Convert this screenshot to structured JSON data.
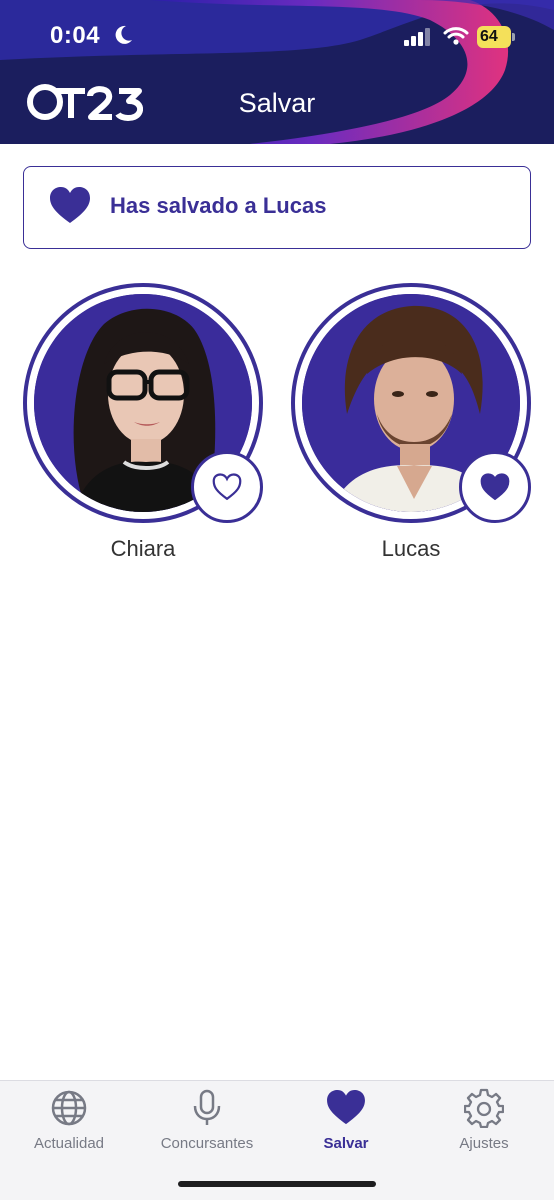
{
  "status_bar": {
    "time": "0:04",
    "battery": "64"
  },
  "header": {
    "logo_text": "OT23",
    "title": "Salvar"
  },
  "banner": {
    "icon": "heart-icon",
    "text": "Has salvado a Lucas"
  },
  "contestants": [
    {
      "name": "Chiara",
      "saved": false,
      "icon": "heart-outline-icon"
    },
    {
      "name": "Lucas",
      "saved": true,
      "icon": "heart-filled-icon"
    }
  ],
  "tabbar": {
    "tabs": [
      {
        "label": "Actualidad",
        "icon": "globe-icon",
        "active": false
      },
      {
        "label": "Concursantes",
        "icon": "microphone-icon",
        "active": false
      },
      {
        "label": "Salvar",
        "icon": "heart-icon",
        "active": true
      },
      {
        "label": "Ajustes",
        "icon": "gear-icon",
        "active": false
      }
    ]
  },
  "colors": {
    "accent": "#3a2f96",
    "header_bg": "#1c1b63",
    "header_swirl": "#d8308a"
  }
}
